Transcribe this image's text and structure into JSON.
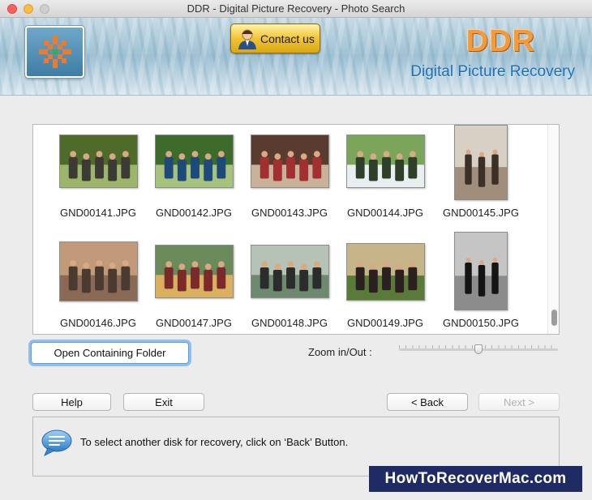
{
  "window": {
    "title": "DDR - Digital Picture Recovery - Photo Search"
  },
  "header": {
    "contact_label": "Contact us",
    "brand": "DDR",
    "subtitle": "Digital Picture Recovery",
    "colors": {
      "brand": "#f39a3c",
      "subtitle": "#1f6fb6",
      "contact_button": "#f2c433"
    }
  },
  "photos": [
    {
      "name": "GND00141.JPG",
      "palette": [
        "#4f6b2a",
        "#9bb56a",
        "#3b3a35"
      ]
    },
    {
      "name": "GND00142.JPG",
      "palette": [
        "#3d6b2c",
        "#a7c27d",
        "#1d4a7a"
      ]
    },
    {
      "name": "GND00143.JPG",
      "palette": [
        "#5a3b2f",
        "#c9b29a",
        "#a33030"
      ]
    },
    {
      "name": "GND00144.JPG",
      "palette": [
        "#7aa55a",
        "#e9eef0",
        "#2e3f2a"
      ]
    },
    {
      "name": "GND00145.JPG",
      "palette": [
        "#d8cfc5",
        "#a18d7b",
        "#3b2f28"
      ]
    },
    {
      "name": "GND00146.JPG",
      "palette": [
        "#c19a7a",
        "#8a6a55",
        "#4a3a30"
      ]
    },
    {
      "name": "GND00147.JPG",
      "palette": [
        "#6a8a5a",
        "#d9b060",
        "#7a2a2a"
      ]
    },
    {
      "name": "GND00148.JPG",
      "palette": [
        "#b7c2b7",
        "#6e8a6e",
        "#2c2c2c"
      ]
    },
    {
      "name": "GND00149.JPG",
      "palette": [
        "#c7b58a",
        "#5a7a3a",
        "#2a2020"
      ]
    },
    {
      "name": "GND00150.JPG",
      "palette": [
        "#c5c5c5",
        "#8c8c8c",
        "#141414"
      ]
    }
  ],
  "controls": {
    "open_folder_label": "Open Containing Folder",
    "zoom_label": "Zoom in/Out :",
    "zoom_level": 0.5
  },
  "buttons": {
    "help": "Help",
    "exit": "Exit",
    "back": "< Back",
    "next": "Next >"
  },
  "info": {
    "message": "To select another disk for recovery, click on ‘Back’ Button."
  },
  "watermark": "HowToRecoverMac.com"
}
